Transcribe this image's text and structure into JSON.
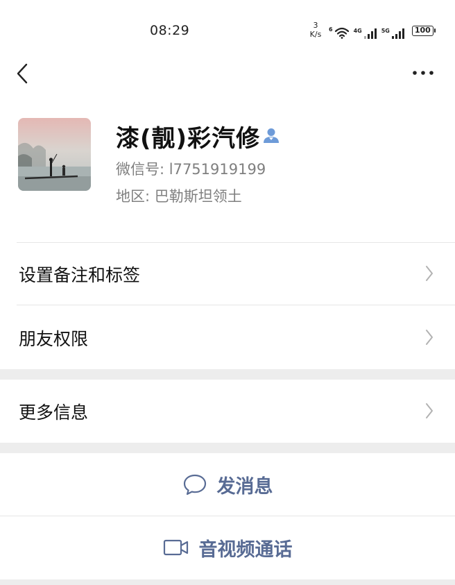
{
  "status_bar": {
    "time": "08:29",
    "net_speed_value": "3",
    "net_speed_unit": "K/s",
    "wifi_badge": "6",
    "sim1_label": "4G",
    "sim2_label": "5G",
    "battery": "100"
  },
  "profile": {
    "name": "漆(靓)彩汽修",
    "wechat_id": "微信号: l7751919199",
    "region": "地区: 巴勒斯坦领土"
  },
  "menu": {
    "remark_tags": "设置备注和标签",
    "friend_permissions": "朋友权限",
    "more_info": "更多信息"
  },
  "actions": {
    "send_message": "发消息",
    "video_call": "音视频通话"
  },
  "icons": {
    "back": "chevron-left-icon",
    "more": "ellipsis-icon",
    "contact": "person-icon",
    "chat": "chat-bubble-icon",
    "video": "video-camera-icon",
    "chevron": "chevron-right-icon"
  },
  "colors": {
    "background": "#ededed",
    "surface": "#ffffff",
    "action_text": "#586b94",
    "secondary_text": "#7f7f7f",
    "contact_badge": "#6e9bd8"
  }
}
